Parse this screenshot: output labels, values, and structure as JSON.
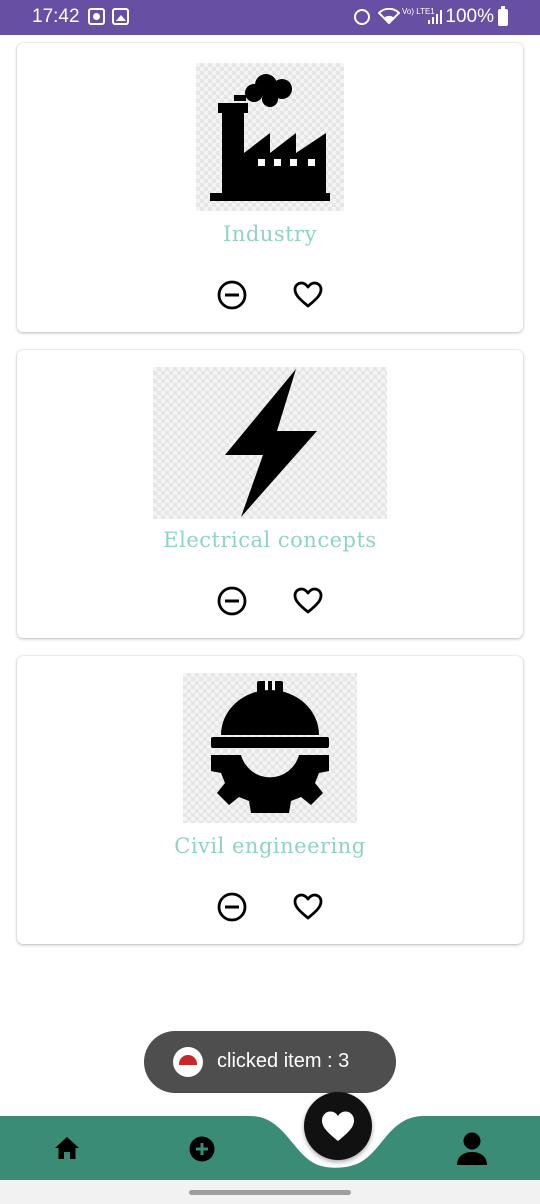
{
  "status_bar": {
    "time": "17:42",
    "lte_label": "Vo) LTE1",
    "battery": "100%"
  },
  "cards": [
    {
      "title": "Industry",
      "icon": "factory-icon"
    },
    {
      "title": "Electrical concepts",
      "icon": "lightning-icon"
    },
    {
      "title": "Civil engineering",
      "icon": "helmet-gear-icon"
    }
  ],
  "toast": {
    "text": "clicked item : 3"
  },
  "colors": {
    "status_bar": "#6750a4",
    "card_title": "#8fd3c4",
    "bottom_nav": "#3a8c76",
    "fab": "#111111",
    "toast": "#4e4e4e"
  },
  "bottom_nav": {
    "items": [
      "home-icon",
      "add-circle-icon",
      "favorite-icon",
      "profile-icon"
    ]
  }
}
